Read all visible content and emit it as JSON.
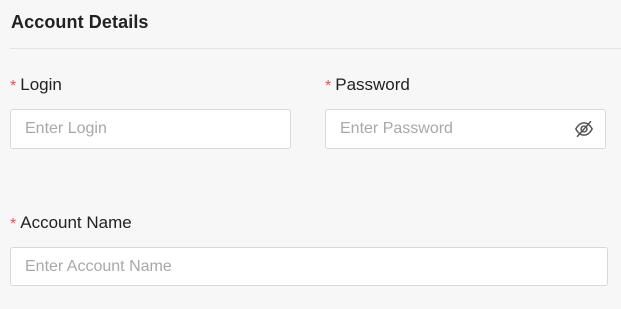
{
  "section": {
    "title": "Account Details"
  },
  "fields": {
    "login": {
      "required_marker": "*",
      "label": "Login",
      "placeholder": "Enter Login",
      "value": ""
    },
    "password": {
      "required_marker": "*",
      "label": "Password",
      "placeholder": "Enter Password",
      "value": "",
      "toggle_icon": "eye-slash-icon"
    },
    "account_name": {
      "required_marker": "*",
      "label": "Account Name",
      "placeholder": "Enter Account Name",
      "value": ""
    }
  },
  "colors": {
    "required": "#e25563",
    "placeholder": "#a8a8a8",
    "border": "#d9d9d9",
    "background": "#f7f7f7"
  }
}
